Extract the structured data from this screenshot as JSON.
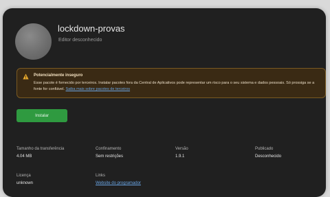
{
  "app": {
    "name": "lockdown-provas",
    "developer": "Editor desconhecido",
    "icon": "generic-app-icon"
  },
  "warning": {
    "icon": "warning-triangle-icon",
    "title": "Potencialmente inseguro",
    "body": "Esse pacote é fornecido por terceiros. Instalar pacotes fora da Central de Aplicativos pode representar um risco para o seu sistema e dados pessoais. Só prossiga se a fonte for confiável.",
    "link": "Saiba mais sobre pacotes de terceiros"
  },
  "install_label": "Instalar",
  "details": {
    "download_size": {
      "label": "Tamanho da transferência",
      "value": "4.04 MB"
    },
    "confinement": {
      "label": "Confinamento",
      "value": "Sem restrições"
    },
    "version": {
      "label": "Versão",
      "value": "1.9.1"
    },
    "published": {
      "label": "Publicado",
      "value": "Desconhecido"
    },
    "license": {
      "label": "Licença",
      "value": "unknown"
    },
    "links": {
      "label": "Links",
      "value": "Website do programador"
    }
  },
  "colors": {
    "window": "#202020",
    "accent_green": "#2f9a40",
    "warning_bg": "#3a2a14",
    "warning_border": "#7a5a22",
    "link": "#6aa6e6"
  }
}
